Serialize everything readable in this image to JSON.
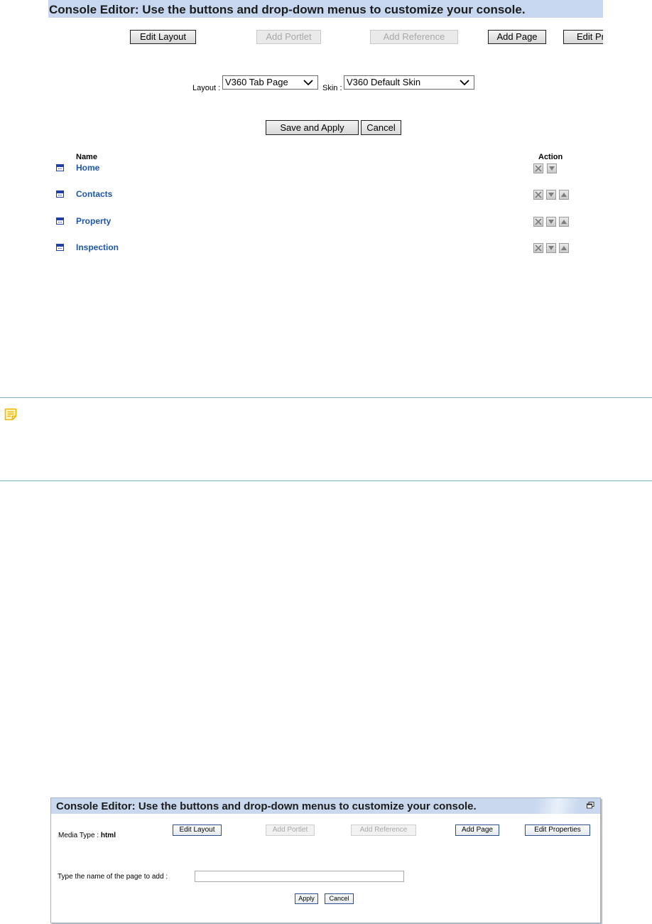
{
  "panel1": {
    "title": "Console Editor: Use the buttons and drop-down menus to customize your console.",
    "toolbar": {
      "edit_layout": "Edit Layout",
      "add_portlet": "Add Portlet",
      "add_reference": "Add Reference",
      "add_page": "Add Page",
      "edit_properties": "Edit Properties"
    },
    "layout_label": "Layout :",
    "layout_value": "V360 Tab Page",
    "skin_label": "Skin :",
    "skin_value": "V360 Default Skin",
    "save_apply": "Save and Apply",
    "cancel": "Cancel",
    "table": {
      "col_name": "Name",
      "col_action": "Action",
      "rows": [
        {
          "name": "Home"
        },
        {
          "name": "Contacts"
        },
        {
          "name": "Property"
        },
        {
          "name": "Inspection"
        }
      ]
    }
  },
  "panel2": {
    "title": "Console Editor: Use the buttons and drop-down menus to customize your console.",
    "media_type_label": "Media Type :",
    "media_type_value": "html",
    "toolbar": {
      "edit_layout": "Edit Layout",
      "add_portlet": "Add Portlet",
      "add_reference": "Add Reference",
      "add_page": "Add Page",
      "edit_properties": "Edit Properties"
    },
    "page_name_label": "Type the name of the page to add :",
    "page_name_value": "",
    "apply": "Apply",
    "cancel": "Cancel"
  },
  "colors": {
    "title_bar": "#c7d7ef",
    "link_blue": "#1f57a8",
    "note_rule": "#7fb1bc",
    "note_icon": "#f2b700"
  },
  "icons": [
    "page-icon",
    "delete-icon",
    "move-down-icon",
    "move-up-icon",
    "note-icon",
    "restore-icon",
    "chevron-down-icon"
  ]
}
